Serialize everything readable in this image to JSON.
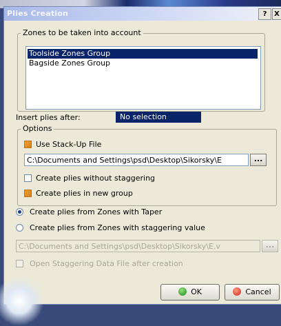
{
  "dialog": {
    "title": "Plies Creation",
    "help_label": "?",
    "close_label": "X"
  },
  "zones": {
    "legend": "Zones to be taken into account",
    "items": [
      "Toolside Zones Group",
      "Bagside Zones Group"
    ],
    "selected_index": 0
  },
  "insert_after": {
    "label": "Insert plies after:",
    "value": "No selection"
  },
  "options": {
    "legend": "Options",
    "use_stackup": {
      "label": "Use Stack-Up File",
      "checked": true
    },
    "stackup_path": "C:\\Documents and Settings\\psd\\Desktop\\Sikorsky\\E",
    "browse_label": "...",
    "no_staggering": {
      "label": "Create plies without staggering",
      "checked": false
    },
    "new_group": {
      "label": "Create plies in new group",
      "checked": true
    }
  },
  "creation_mode": {
    "taper": {
      "label": "Create plies from Zones with Taper",
      "selected": true
    },
    "staggering": {
      "label": "Create plies from Zones with staggering value",
      "selected": false
    },
    "staggering_path": "C:\\Documents and Settings\\psd\\Desktop\\Sikorsky\\E.v",
    "browse_label": "..."
  },
  "open_staggering": {
    "label": "Open Staggering Data File after creation",
    "checked": false,
    "enabled": false
  },
  "buttons": {
    "ok": "OK",
    "cancel": "Cancel"
  },
  "colors": {
    "selection": "#0a246a",
    "dialog_bg": "#ece9d8",
    "accent_checkbox": "#f0a030"
  }
}
